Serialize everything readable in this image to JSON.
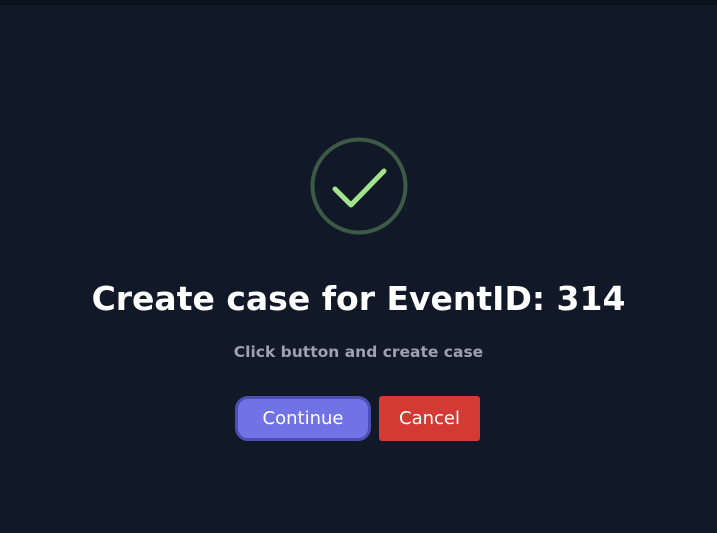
{
  "dialog": {
    "icon": "check-circle-icon",
    "title": "Create case for EventID: 314",
    "subtitle": "Click button and create case",
    "continue_label": "Continue",
    "cancel_label": "Cancel"
  },
  "colors": {
    "background": "#111827",
    "icon_ring": "#3d5a47",
    "icon_check": "#a3e38d",
    "continue_button": "#7172e6",
    "continue_border": "#4c4fb3",
    "cancel_button": "#d33a33",
    "title_text": "#ffffff",
    "subtitle_text": "#9ca3af"
  }
}
